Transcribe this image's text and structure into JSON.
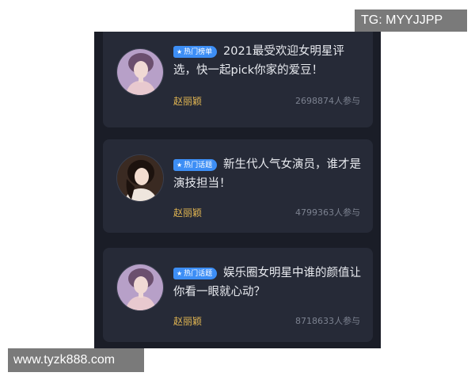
{
  "colors": {
    "panel_bg": "#1a1d27",
    "card_bg": "#262a37",
    "badge_bg": "#3d8ef5",
    "author": "#e2b652",
    "title": "#e9ebf0",
    "participants": "#7c8290"
  },
  "cards": [
    {
      "badge": "热门榜单",
      "badge_icon": "star-icon",
      "title": "2021最受欢迎女明星评选，快一起pick你家的爱豆！",
      "author": "赵丽颖",
      "participants": "2698874人参与"
    },
    {
      "badge": "热门话题",
      "badge_icon": "star-icon",
      "title": "新生代人气女演员，谁才是演技担当！",
      "author": "赵丽颖",
      "participants": "4799363人参与"
    },
    {
      "badge": "热门话题",
      "badge_icon": "star-icon",
      "title": "娱乐圈女明星中谁的颜值让你看一眼就心动？",
      "author": "赵丽颖",
      "participants": "8718633人参与"
    }
  ],
  "watermarks": {
    "top_right": "TG: MYYJJPP",
    "bottom_left": "www.tyzk888.com"
  }
}
